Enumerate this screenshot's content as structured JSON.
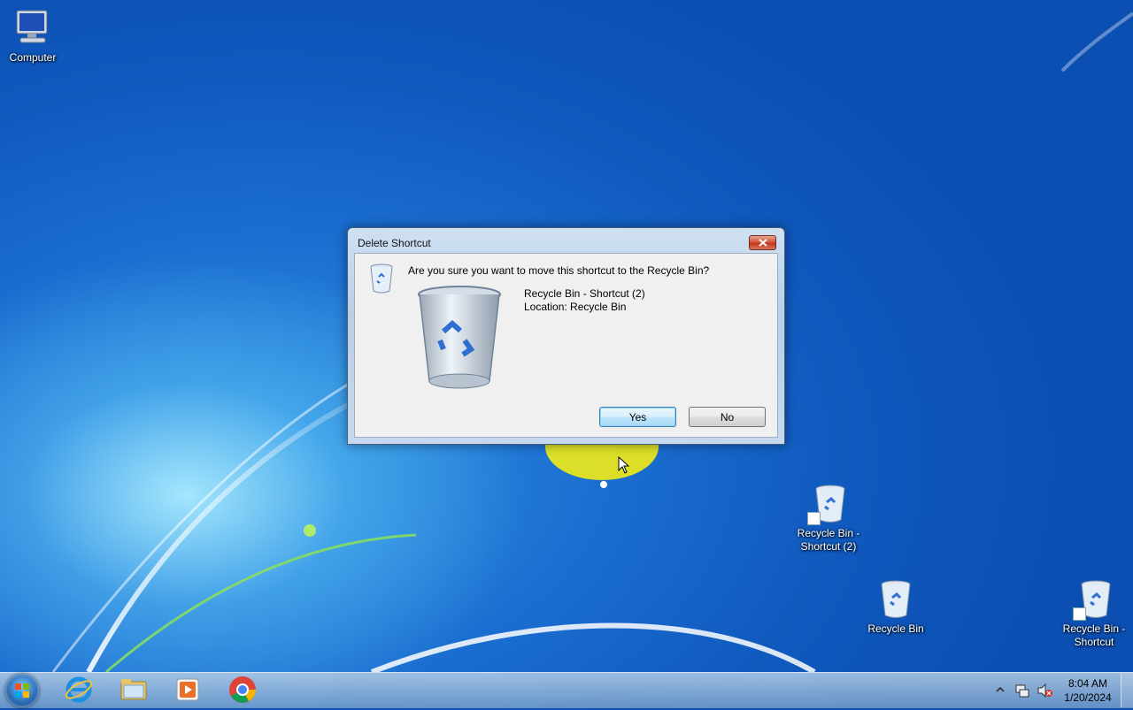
{
  "desktop": {
    "icons": [
      {
        "label": "Computer",
        "icon": "computer-icon"
      },
      {
        "label": "Recycle Bin - Shortcut (2)",
        "icon": "recycle-bin-shortcut-icon"
      },
      {
        "label": "Recycle Bin",
        "icon": "recycle-bin-icon"
      },
      {
        "label": "Recycle Bin - Shortcut",
        "icon": "recycle-bin-shortcut-icon"
      }
    ]
  },
  "dialog": {
    "title": "Delete Shortcut",
    "question": "Are you sure you want to move this shortcut to the Recycle Bin?",
    "item_name": "Recycle Bin - Shortcut (2)",
    "item_location": "Location: Recycle Bin",
    "yes_label": "Yes",
    "no_label": "No"
  },
  "taskbar": {
    "pinned": [
      "start-orb",
      "internet-explorer-icon",
      "file-explorer-icon",
      "media-player-icon",
      "chrome-icon"
    ],
    "tray": {
      "time": "8:04 AM",
      "date": "1/20/2024"
    }
  },
  "colors": {
    "desktop_blue": "#1a6ccf",
    "dialog_frame": "#b9cfe8",
    "close_red": "#c0381c",
    "default_button_border": "#3c7fb1"
  }
}
